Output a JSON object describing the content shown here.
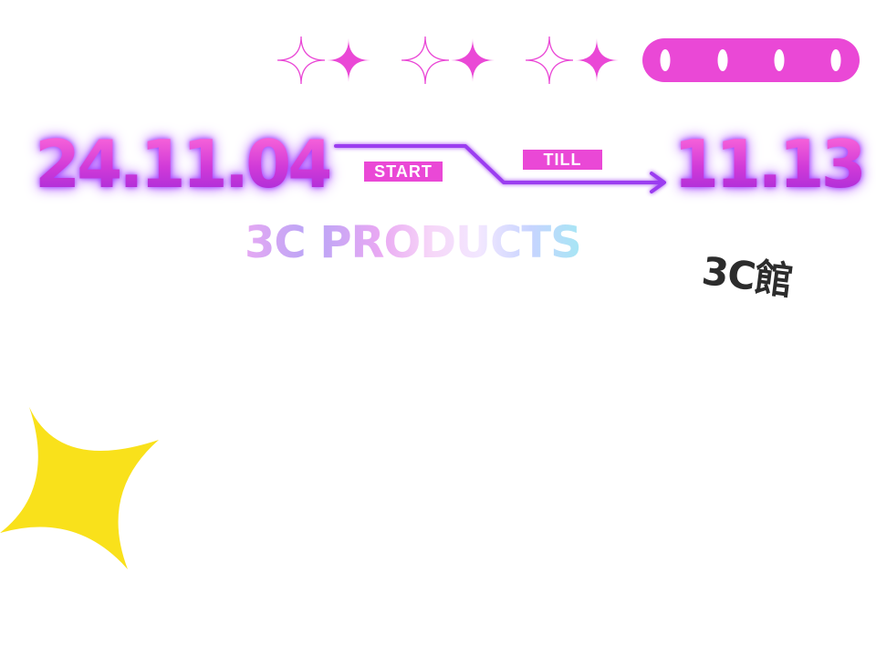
{
  "promo": {
    "start_date": "24.11.04",
    "end_date": "11.13",
    "start_label": "START",
    "till_label": "TILL",
    "title": "3C PRODUCTS",
    "hall_label": "3C館"
  },
  "decor": {
    "sparkle_pairs": 3,
    "pill_dots": 4,
    "icons": [
      "sparkle-outline-icon",
      "sparkle-filled-icon",
      "chain-pill-icon",
      "four-point-star-icon",
      "arrow-icon"
    ]
  },
  "colors": {
    "magenta": "#ea48d6",
    "violet": "#9b3cf0",
    "star_yellow": "#f9e11b",
    "text_dark": "#2c2c2c",
    "background": "#ffffff"
  }
}
